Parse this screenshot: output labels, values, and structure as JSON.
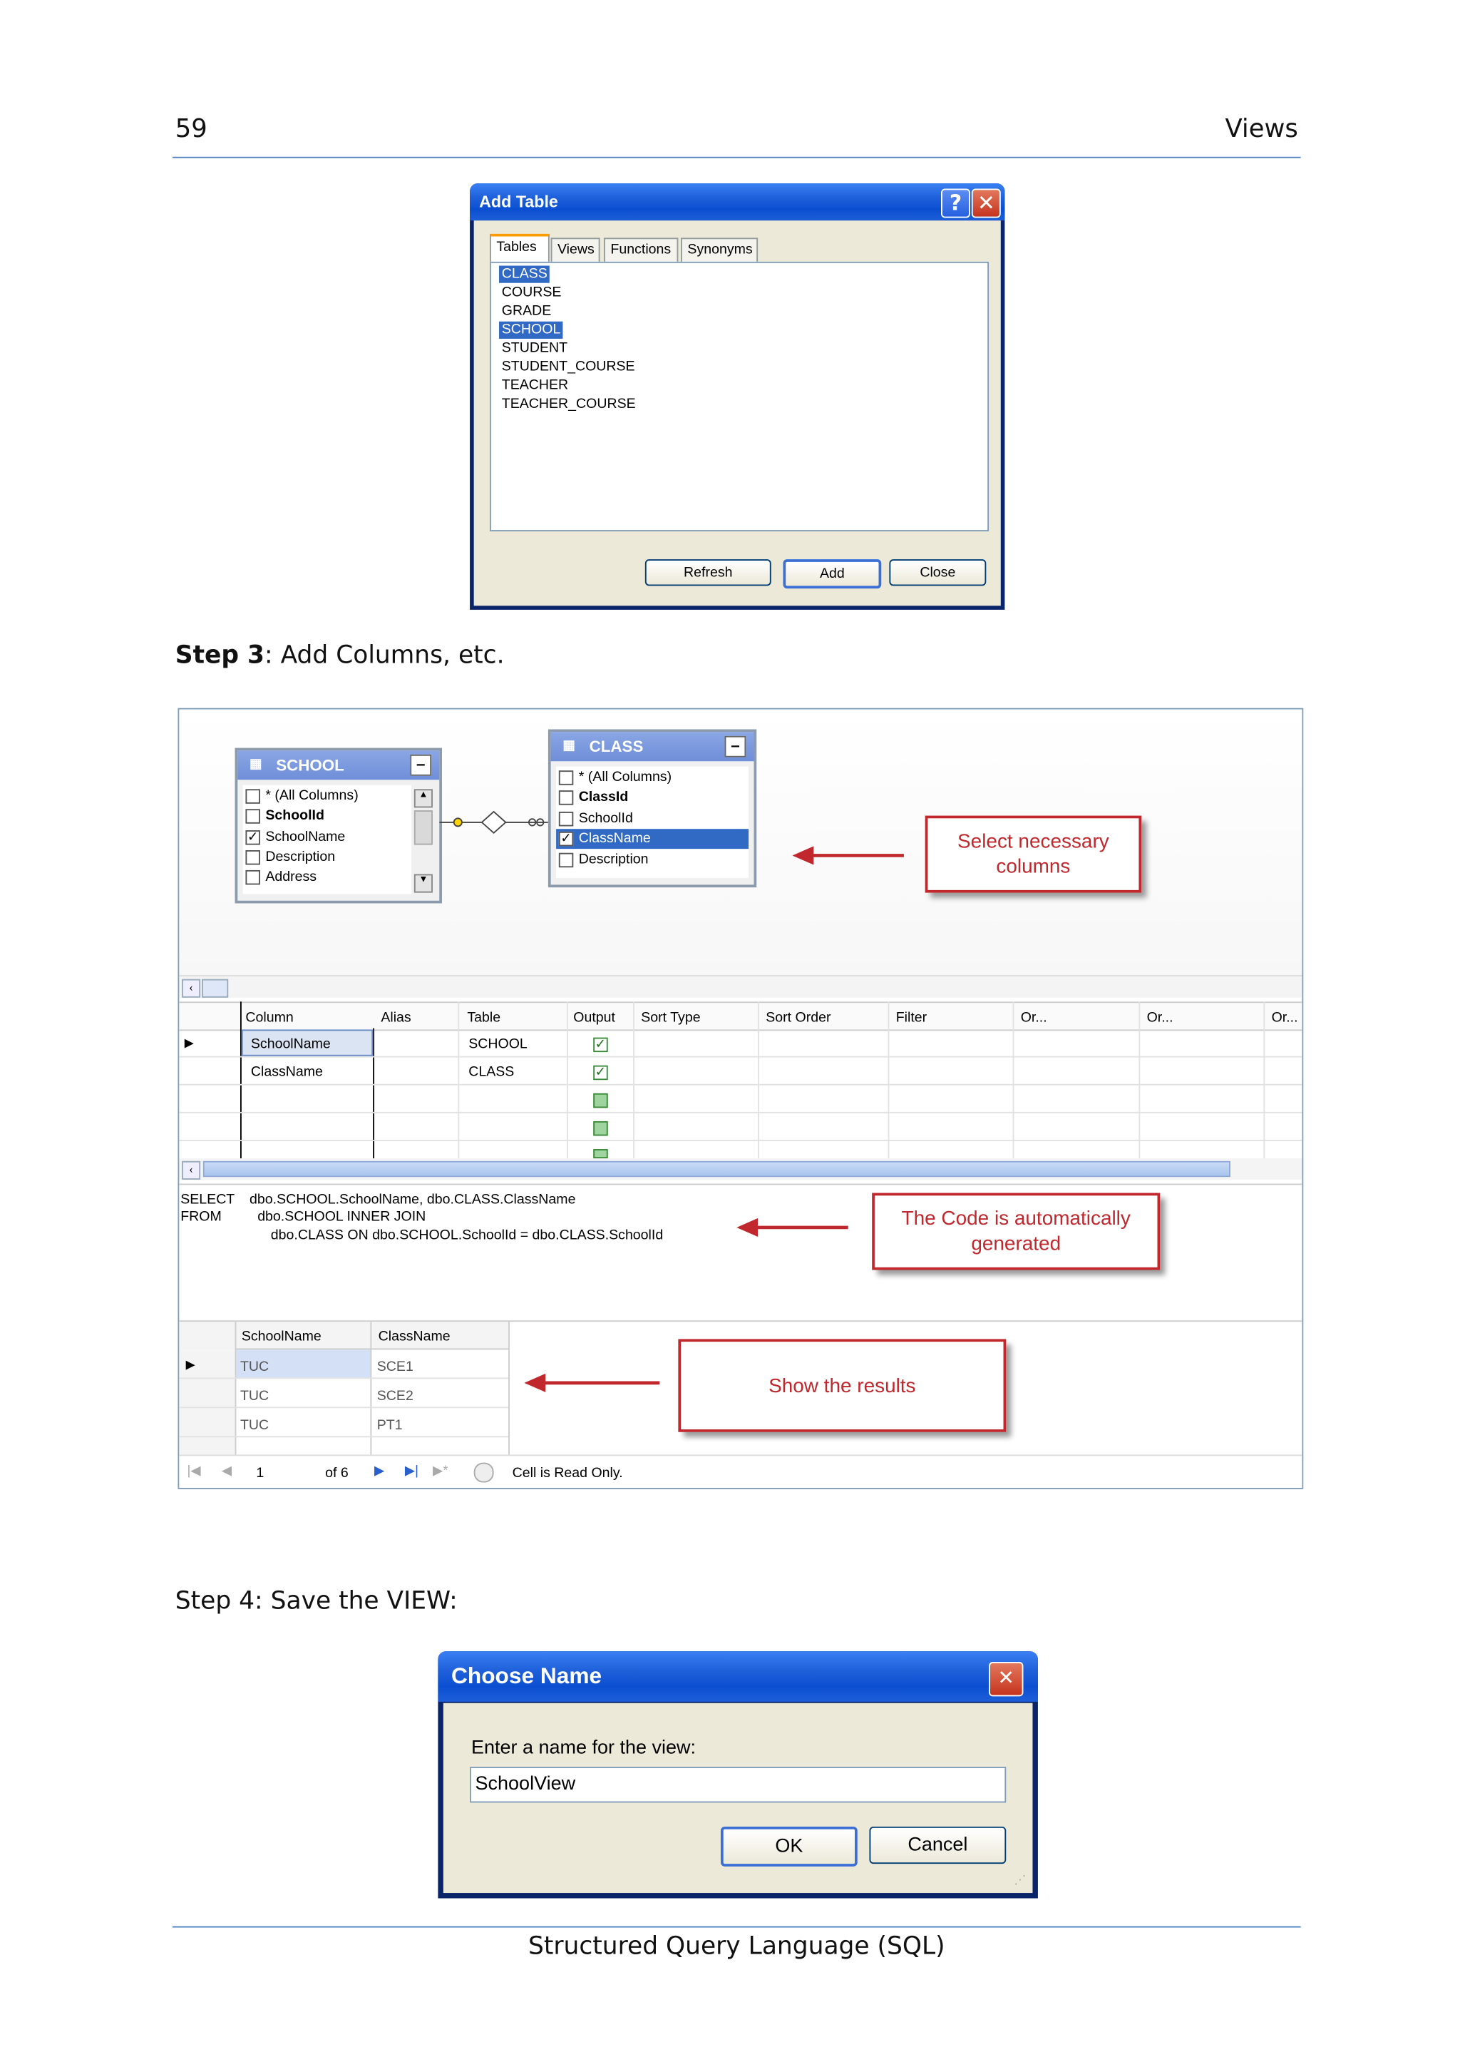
{
  "header": {
    "page_number": "59",
    "section": "Views"
  },
  "add_table_dialog": {
    "title": "Add Table",
    "tabs": [
      "Tables",
      "Views",
      "Functions",
      "Synonyms"
    ],
    "items": [
      "CLASS",
      "COURSE",
      "GRADE",
      "SCHOOL",
      "STUDENT",
      "STUDENT_COURSE",
      "TEACHER",
      "TEACHER_COURSE"
    ],
    "buttons": {
      "refresh": "Refresh",
      "add": "Add",
      "close": "Close"
    }
  },
  "step3": {
    "bold": "Step 3",
    "text": ": Add Columns, etc."
  },
  "designer": {
    "school_table": {
      "title": "SCHOOL",
      "columns": [
        "* (All Columns)",
        "SchoolId",
        "SchoolName",
        "Description",
        "Address"
      ]
    },
    "class_table": {
      "title": "CLASS",
      "columns": [
        "* (All Columns)",
        "ClassId",
        "SchoolId",
        "ClassName",
        "Description"
      ]
    },
    "callout_select": "Select necessary columns",
    "grid": {
      "headers": [
        "Column",
        "Alias",
        "Table",
        "Output",
        "Sort Type",
        "Sort Order",
        "Filter",
        "Or...",
        "Or...",
        "Or..."
      ],
      "rows": [
        {
          "column": "SchoolName",
          "table": "SCHOOL"
        },
        {
          "column": "ClassName",
          "table": "CLASS"
        }
      ]
    },
    "sql": {
      "line1_kw": "SELECT",
      "line1": "dbo.SCHOOL.SchoolName, dbo.CLASS.ClassName",
      "line2_kw": "FROM",
      "line2": "dbo.SCHOOL INNER JOIN",
      "line3": "dbo.CLASS ON dbo.SCHOOL.SchoolId = dbo.CLASS.SchoolId"
    },
    "callout_code": "The Code is automatically generated",
    "results": {
      "headers": [
        "SchoolName",
        "ClassName"
      ],
      "rows": [
        [
          "TUC",
          "SCE1"
        ],
        [
          "TUC",
          "SCE2"
        ],
        [
          "TUC",
          "PT1"
        ]
      ]
    },
    "callout_results": "Show the results",
    "nav": {
      "current": "1",
      "of": "of 6",
      "status": "Cell is Read Only."
    }
  },
  "step4": "Step 4: Save the VIEW:",
  "choose_name_dialog": {
    "title": "Choose Name",
    "prompt": "Enter a name for the view:",
    "value": "SchoolView",
    "ok": "OK",
    "cancel": "Cancel"
  },
  "footer": "Structured Query Language (SQL)"
}
